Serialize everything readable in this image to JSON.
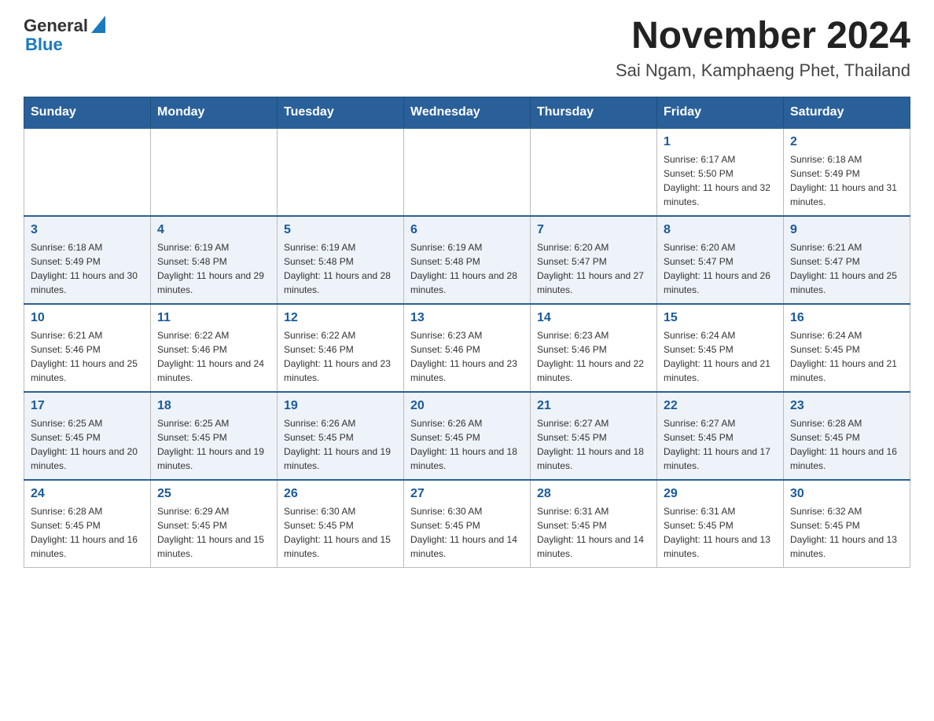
{
  "logo": {
    "text_general": "General",
    "text_blue": "Blue",
    "triangle": "▶"
  },
  "title": "November 2024",
  "subtitle": "Sai Ngam, Kamphaeng Phet, Thailand",
  "weekdays": [
    "Sunday",
    "Monday",
    "Tuesday",
    "Wednesday",
    "Thursday",
    "Friday",
    "Saturday"
  ],
  "weeks": [
    [
      {
        "day": "",
        "info": ""
      },
      {
        "day": "",
        "info": ""
      },
      {
        "day": "",
        "info": ""
      },
      {
        "day": "",
        "info": ""
      },
      {
        "day": "",
        "info": ""
      },
      {
        "day": "1",
        "info": "Sunrise: 6:17 AM\nSunset: 5:50 PM\nDaylight: 11 hours and 32 minutes."
      },
      {
        "day": "2",
        "info": "Sunrise: 6:18 AM\nSunset: 5:49 PM\nDaylight: 11 hours and 31 minutes."
      }
    ],
    [
      {
        "day": "3",
        "info": "Sunrise: 6:18 AM\nSunset: 5:49 PM\nDaylight: 11 hours and 30 minutes."
      },
      {
        "day": "4",
        "info": "Sunrise: 6:19 AM\nSunset: 5:48 PM\nDaylight: 11 hours and 29 minutes."
      },
      {
        "day": "5",
        "info": "Sunrise: 6:19 AM\nSunset: 5:48 PM\nDaylight: 11 hours and 28 minutes."
      },
      {
        "day": "6",
        "info": "Sunrise: 6:19 AM\nSunset: 5:48 PM\nDaylight: 11 hours and 28 minutes."
      },
      {
        "day": "7",
        "info": "Sunrise: 6:20 AM\nSunset: 5:47 PM\nDaylight: 11 hours and 27 minutes."
      },
      {
        "day": "8",
        "info": "Sunrise: 6:20 AM\nSunset: 5:47 PM\nDaylight: 11 hours and 26 minutes."
      },
      {
        "day": "9",
        "info": "Sunrise: 6:21 AM\nSunset: 5:47 PM\nDaylight: 11 hours and 25 minutes."
      }
    ],
    [
      {
        "day": "10",
        "info": "Sunrise: 6:21 AM\nSunset: 5:46 PM\nDaylight: 11 hours and 25 minutes."
      },
      {
        "day": "11",
        "info": "Sunrise: 6:22 AM\nSunset: 5:46 PM\nDaylight: 11 hours and 24 minutes."
      },
      {
        "day": "12",
        "info": "Sunrise: 6:22 AM\nSunset: 5:46 PM\nDaylight: 11 hours and 23 minutes."
      },
      {
        "day": "13",
        "info": "Sunrise: 6:23 AM\nSunset: 5:46 PM\nDaylight: 11 hours and 23 minutes."
      },
      {
        "day": "14",
        "info": "Sunrise: 6:23 AM\nSunset: 5:46 PM\nDaylight: 11 hours and 22 minutes."
      },
      {
        "day": "15",
        "info": "Sunrise: 6:24 AM\nSunset: 5:45 PM\nDaylight: 11 hours and 21 minutes."
      },
      {
        "day": "16",
        "info": "Sunrise: 6:24 AM\nSunset: 5:45 PM\nDaylight: 11 hours and 21 minutes."
      }
    ],
    [
      {
        "day": "17",
        "info": "Sunrise: 6:25 AM\nSunset: 5:45 PM\nDaylight: 11 hours and 20 minutes."
      },
      {
        "day": "18",
        "info": "Sunrise: 6:25 AM\nSunset: 5:45 PM\nDaylight: 11 hours and 19 minutes."
      },
      {
        "day": "19",
        "info": "Sunrise: 6:26 AM\nSunset: 5:45 PM\nDaylight: 11 hours and 19 minutes."
      },
      {
        "day": "20",
        "info": "Sunrise: 6:26 AM\nSunset: 5:45 PM\nDaylight: 11 hours and 18 minutes."
      },
      {
        "day": "21",
        "info": "Sunrise: 6:27 AM\nSunset: 5:45 PM\nDaylight: 11 hours and 18 minutes."
      },
      {
        "day": "22",
        "info": "Sunrise: 6:27 AM\nSunset: 5:45 PM\nDaylight: 11 hours and 17 minutes."
      },
      {
        "day": "23",
        "info": "Sunrise: 6:28 AM\nSunset: 5:45 PM\nDaylight: 11 hours and 16 minutes."
      }
    ],
    [
      {
        "day": "24",
        "info": "Sunrise: 6:28 AM\nSunset: 5:45 PM\nDaylight: 11 hours and 16 minutes."
      },
      {
        "day": "25",
        "info": "Sunrise: 6:29 AM\nSunset: 5:45 PM\nDaylight: 11 hours and 15 minutes."
      },
      {
        "day": "26",
        "info": "Sunrise: 6:30 AM\nSunset: 5:45 PM\nDaylight: 11 hours and 15 minutes."
      },
      {
        "day": "27",
        "info": "Sunrise: 6:30 AM\nSunset: 5:45 PM\nDaylight: 11 hours and 14 minutes."
      },
      {
        "day": "28",
        "info": "Sunrise: 6:31 AM\nSunset: 5:45 PM\nDaylight: 11 hours and 14 minutes."
      },
      {
        "day": "29",
        "info": "Sunrise: 6:31 AM\nSunset: 5:45 PM\nDaylight: 11 hours and 13 minutes."
      },
      {
        "day": "30",
        "info": "Sunrise: 6:32 AM\nSunset: 5:45 PM\nDaylight: 11 hours and 13 minutes."
      }
    ]
  ]
}
